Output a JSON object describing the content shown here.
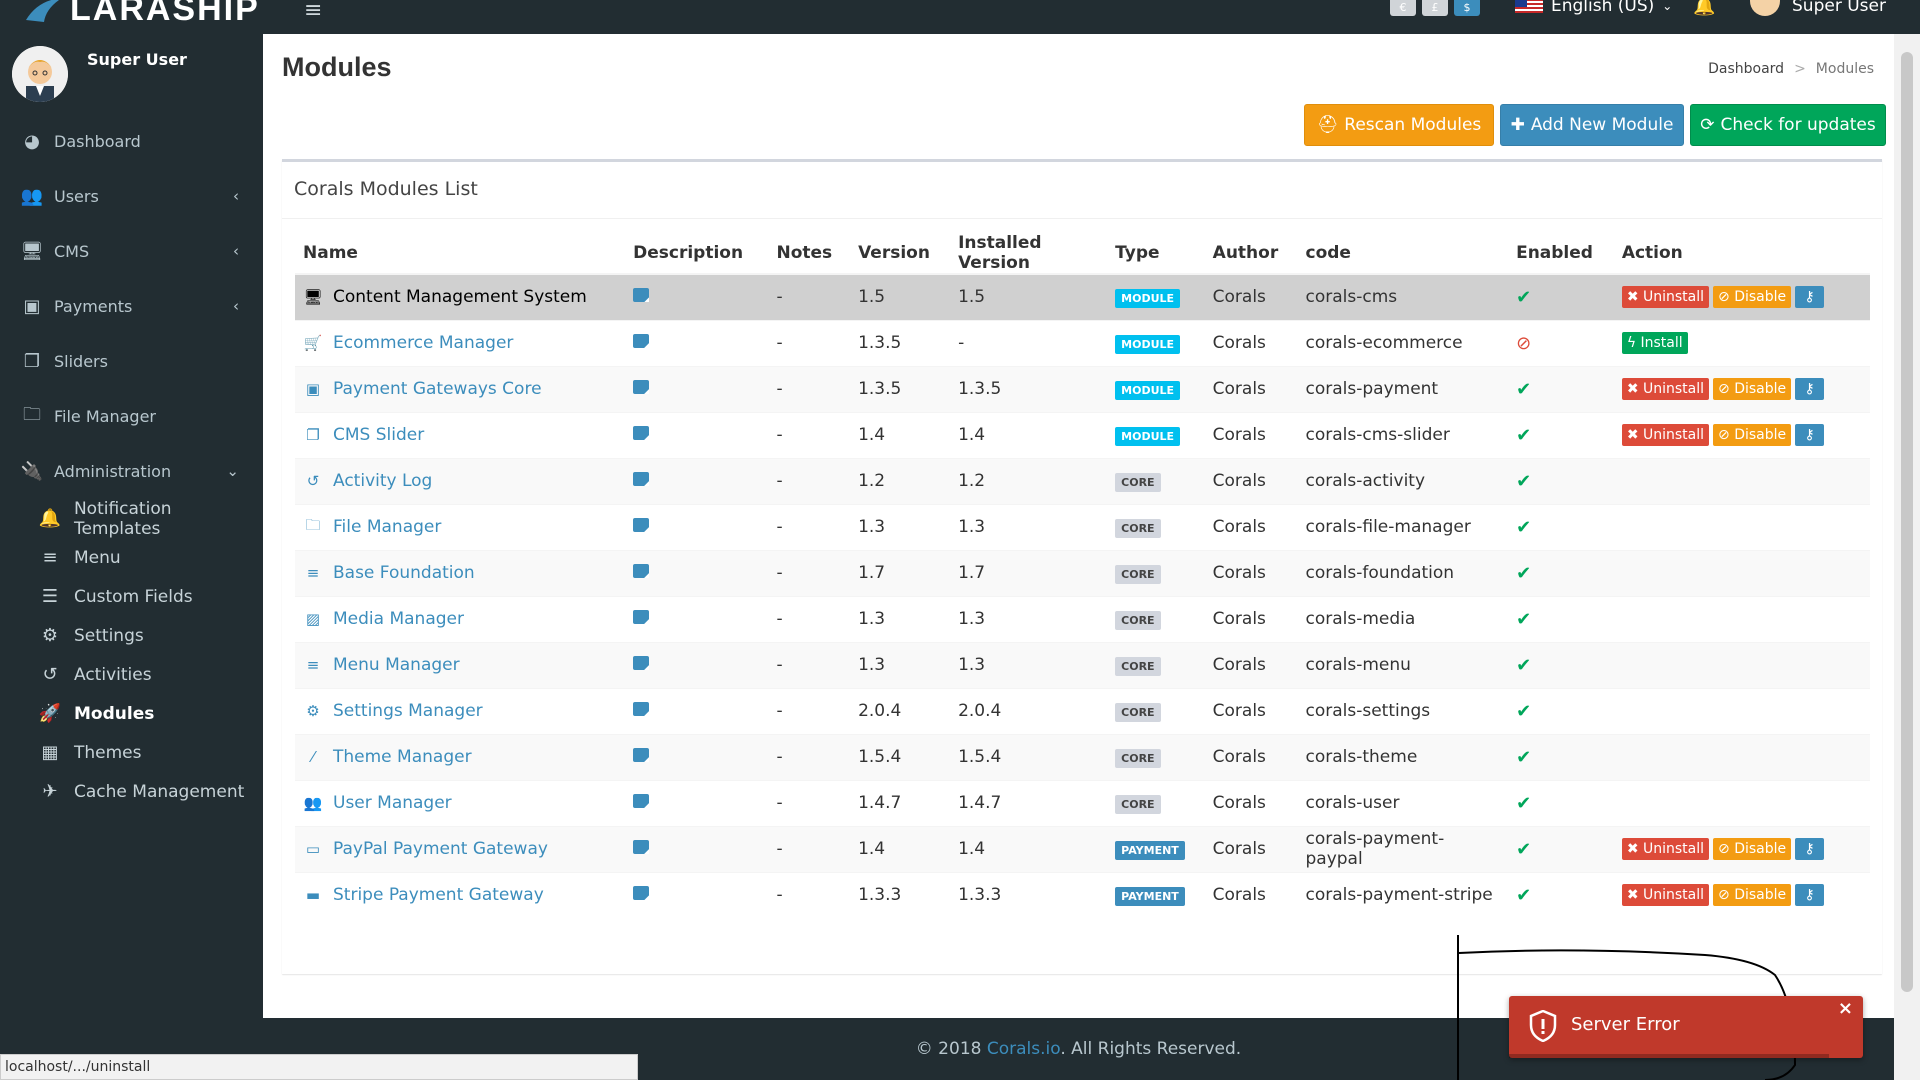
{
  "app": {
    "logo_text": "LARASHIP"
  },
  "topbar": {
    "currency_buttons": [
      "€",
      "£",
      "$"
    ],
    "language": "English (US)",
    "user_name": "Super User"
  },
  "sidebar": {
    "user_name": "Super User",
    "items": [
      {
        "label": "Dashboard",
        "icon": "dashboard-icon"
      },
      {
        "label": "Users",
        "icon": "users-icon",
        "has_children": true
      },
      {
        "label": "CMS",
        "icon": "desktop-icon",
        "has_children": true
      },
      {
        "label": "Payments",
        "icon": "money-icon",
        "has_children": true
      },
      {
        "label": "Sliders",
        "icon": "clone-icon"
      },
      {
        "label": "File Manager",
        "icon": "folder-icon"
      },
      {
        "label": "Administration",
        "icon": "plug-icon",
        "expanded": true
      }
    ],
    "admin_sub_items": [
      {
        "label": "Notification Templates",
        "icon": "bell-icon"
      },
      {
        "label": "Menu",
        "icon": "bars-icon"
      },
      {
        "label": "Custom Fields",
        "icon": "list-icon"
      },
      {
        "label": "Settings",
        "icon": "cogs-icon"
      },
      {
        "label": "Activities",
        "icon": "history-icon"
      },
      {
        "label": "Modules",
        "icon": "rocket-icon",
        "active": true
      },
      {
        "label": "Themes",
        "icon": "themes-icon"
      },
      {
        "label": "Cache Management",
        "icon": "plane-icon"
      }
    ]
  },
  "page": {
    "title": "Modules",
    "breadcrumb": [
      "Dashboard",
      "Modules"
    ],
    "buttons": {
      "rescan": "Rescan Modules",
      "add": "Add New Module",
      "check": "Check for updates"
    },
    "box_title": "Corals Modules List"
  },
  "table": {
    "columns": [
      "Name",
      "Description",
      "Notes",
      "Version",
      "Installed Version",
      "Type",
      "Author",
      "code",
      "Enabled",
      "Action"
    ],
    "action_labels": {
      "uninstall": "Uninstall",
      "disable": "Disable",
      "install": "Install"
    },
    "rows": [
      {
        "name": "Content Management System",
        "icon": "desktop-icon",
        "notes": "-",
        "version": "1.5",
        "installed": "1.5",
        "type": "MODULE",
        "author": "Corals",
        "code": "corals-cms",
        "enabled": true,
        "actions": "manage",
        "highlight": true
      },
      {
        "name": "Ecommerce Manager",
        "icon": "cart-icon",
        "notes": "-",
        "version": "1.3.5",
        "installed": "-",
        "type": "MODULE",
        "author": "Corals",
        "code": "corals-ecommerce",
        "enabled": false,
        "actions": "install"
      },
      {
        "name": "Payment Gateways Core",
        "icon": "money-icon",
        "notes": "-",
        "version": "1.3.5",
        "installed": "1.3.5",
        "type": "MODULE",
        "author": "Corals",
        "code": "corals-payment",
        "enabled": true,
        "actions": "manage"
      },
      {
        "name": "CMS Slider",
        "icon": "clone-icon",
        "notes": "-",
        "version": "1.4",
        "installed": "1.4",
        "type": "MODULE",
        "author": "Corals",
        "code": "corals-cms-slider",
        "enabled": true,
        "actions": "manage"
      },
      {
        "name": "Activity Log",
        "icon": "history-icon",
        "notes": "-",
        "version": "1.2",
        "installed": "1.2",
        "type": "CORE",
        "author": "Corals",
        "code": "corals-activity",
        "enabled": true,
        "actions": "none"
      },
      {
        "name": "File Manager",
        "icon": "folder-icon",
        "notes": "-",
        "version": "1.3",
        "installed": "1.3",
        "type": "CORE",
        "author": "Corals",
        "code": "corals-file-manager",
        "enabled": true,
        "actions": "none"
      },
      {
        "name": "Base Foundation",
        "icon": "bars-icon",
        "notes": "-",
        "version": "1.7",
        "installed": "1.7",
        "type": "CORE",
        "author": "Corals",
        "code": "corals-foundation",
        "enabled": true,
        "actions": "none"
      },
      {
        "name": "Media Manager",
        "icon": "image-icon",
        "notes": "-",
        "version": "1.3",
        "installed": "1.3",
        "type": "CORE",
        "author": "Corals",
        "code": "corals-media",
        "enabled": true,
        "actions": "none"
      },
      {
        "name": "Menu Manager",
        "icon": "bars-icon",
        "notes": "-",
        "version": "1.3",
        "installed": "1.3",
        "type": "CORE",
        "author": "Corals",
        "code": "corals-menu",
        "enabled": true,
        "actions": "none"
      },
      {
        "name": "Settings Manager",
        "icon": "cogs-icon",
        "notes": "-",
        "version": "2.0.4",
        "installed": "2.0.4",
        "type": "CORE",
        "author": "Corals",
        "code": "corals-settings",
        "enabled": true,
        "actions": "none"
      },
      {
        "name": "Theme Manager",
        "icon": "magic-icon",
        "notes": "-",
        "version": "1.5.4",
        "installed": "1.5.4",
        "type": "CORE",
        "author": "Corals",
        "code": "corals-theme",
        "enabled": true,
        "actions": "none"
      },
      {
        "name": "User Manager",
        "icon": "users-icon",
        "notes": "-",
        "version": "1.4.7",
        "installed": "1.4.7",
        "type": "CORE",
        "author": "Corals",
        "code": "corals-user",
        "enabled": true,
        "actions": "none"
      },
      {
        "name": "PayPal Payment Gateway",
        "icon": "paypal-icon",
        "notes": "-",
        "version": "1.4",
        "installed": "1.4",
        "type": "PAYMENT",
        "author": "Corals",
        "code": "corals-payment-paypal",
        "enabled": true,
        "actions": "manage"
      },
      {
        "name": "Stripe Payment Gateway",
        "icon": "stripe-icon",
        "notes": "-",
        "version": "1.3.3",
        "installed": "1.3.3",
        "type": "PAYMENT",
        "author": "Corals",
        "code": "corals-payment-stripe",
        "enabled": true,
        "actions": "manage"
      }
    ]
  },
  "footer": {
    "prefix": "© 2018 ",
    "link": "Corals.io",
    "suffix": ". All Rights Reserved."
  },
  "status_bar": {
    "url": "localhost/.../uninstall"
  },
  "toast": {
    "message": "Server Error",
    "close": "×"
  },
  "colors": {
    "sidebar_bg": "#222d32",
    "primary": "#3c8dbc",
    "success": "#00a65a",
    "warning": "#f39c12",
    "danger": "#dd4b39",
    "toast": "#c0392b"
  }
}
